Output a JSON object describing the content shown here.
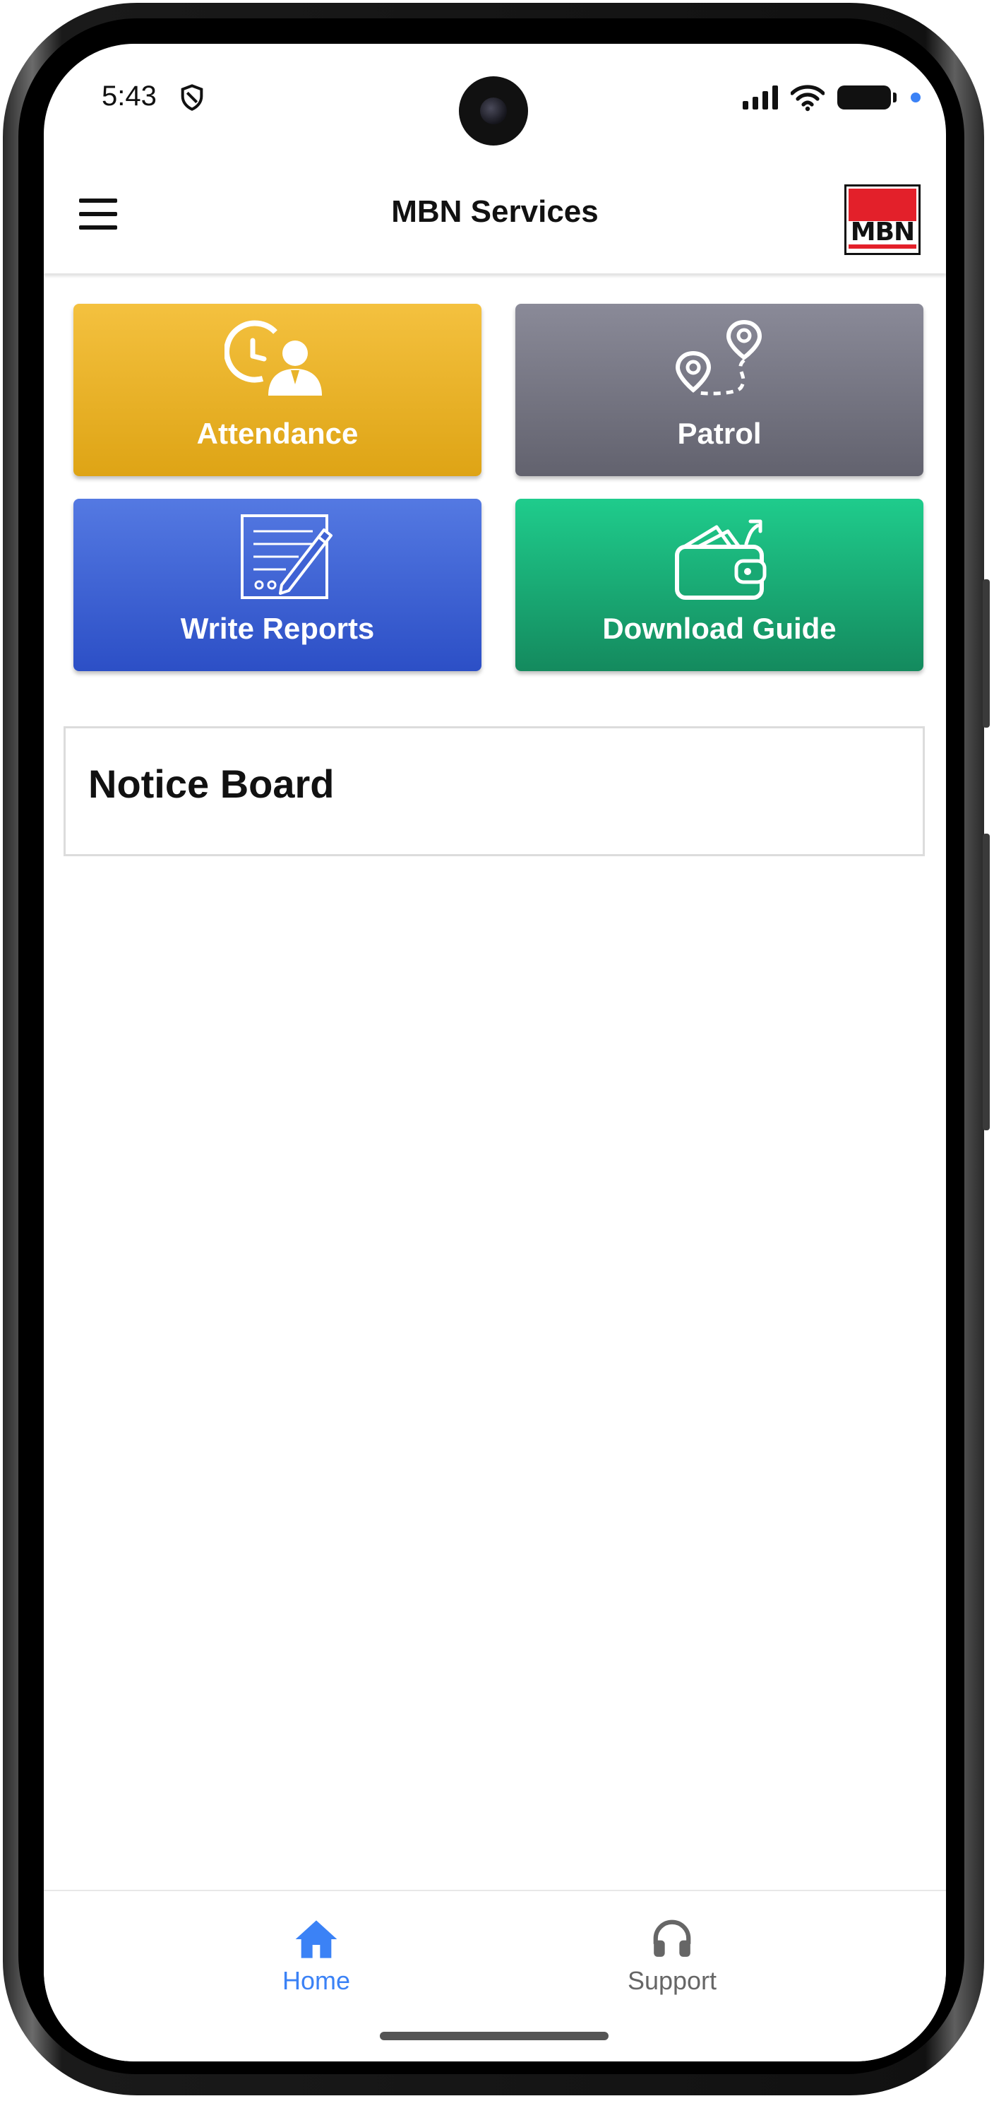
{
  "status_bar": {
    "time": "5:43",
    "icons": [
      "shield-icon",
      "signal-icon",
      "wifi-icon",
      "battery-icon",
      "notification-dot"
    ]
  },
  "appbar": {
    "title": "MBN Services",
    "logo_text": "MBN",
    "menu_icon": "hamburger-menu-icon"
  },
  "tiles": [
    {
      "label": "Attendance",
      "icon": "attendance-clock-person-icon",
      "color": "#e8b42a"
    },
    {
      "label": "Patrol",
      "icon": "patrol-route-pins-icon",
      "color": "#767684"
    },
    {
      "label": "Write Reports",
      "icon": "write-report-document-icon",
      "color": "#3f62d4"
    },
    {
      "label": "Download Guide",
      "icon": "download-guide-wallet-icon",
      "color": "#18a873"
    }
  ],
  "notice_board": {
    "title": "Notice Board"
  },
  "bottom_nav": {
    "items": [
      {
        "label": "Home",
        "icon": "home-icon",
        "active": true,
        "color": "#3b82f6"
      },
      {
        "label": "Support",
        "icon": "headphones-icon",
        "active": false,
        "color": "#666666"
      }
    ]
  }
}
